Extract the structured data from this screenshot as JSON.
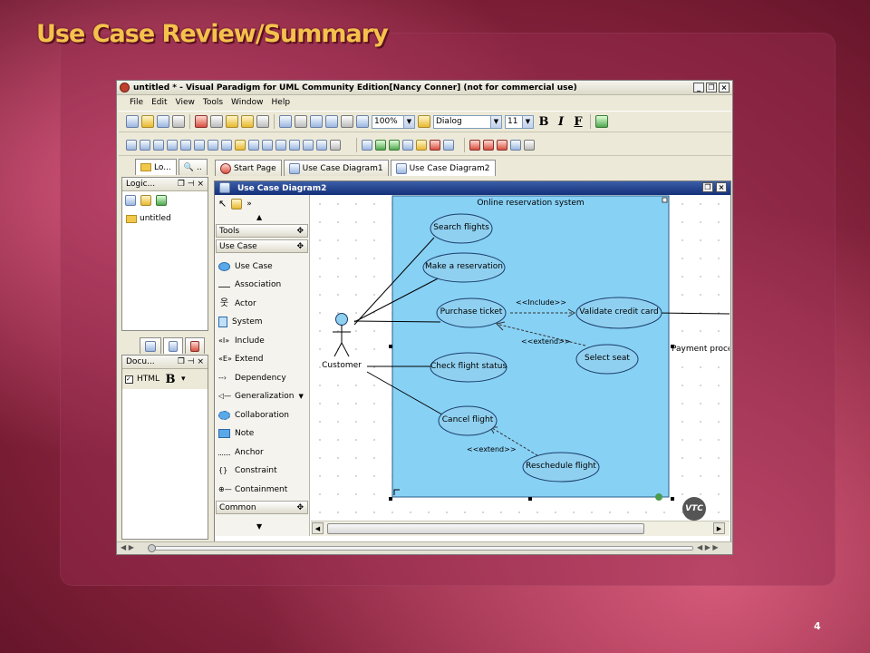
{
  "slide": {
    "title": "Use Case Review/Summary",
    "page_number": "4"
  },
  "window": {
    "title": "untitled * - Visual Paradigm for UML Community Edition[Nancy Conner] (not for commercial use)",
    "menu": [
      "File",
      "Edit",
      "View",
      "Tools",
      "Window",
      "Help"
    ],
    "zoom": "100%",
    "font_name": "Dialog",
    "font_size": "11",
    "format_buttons": [
      "B",
      "I",
      "F"
    ]
  },
  "left_panels": {
    "top_tabs": [
      "Lo...",
      ".."
    ],
    "logical_title": "Logic...",
    "tree_item": "untitled",
    "doc_title": "Docu...",
    "html_label": "HTML",
    "html_bold": "B"
  },
  "doc_tabs": [
    "Start Page",
    "Use Case Diagram1",
    "Use Case Diagram2"
  ],
  "diagram": {
    "title": "Use Case Diagram2",
    "palette_sections": [
      "Tools",
      "Use Case",
      "Common"
    ],
    "palette_items": [
      "Use Case",
      "Association",
      "Actor",
      "System",
      "Include",
      "Extend",
      "Dependency",
      "Generalization",
      "Collaboration",
      "Note",
      "Anchor",
      "Constraint",
      "Containment"
    ],
    "system_name": "Online reservation system",
    "actor": "Customer",
    "use_cases": [
      "Search flights",
      "Make a reservation",
      "Purchase ticket",
      "Validate credit card",
      "Select seat",
      "Check flight status",
      "Cancel flight",
      "Reschedule flight"
    ],
    "relations": {
      "include": "<<Include>>",
      "extend1": "<<extend>>",
      "extend2": "<<extend>>"
    },
    "external_actor": "Payment proce",
    "watermark": "VTC"
  },
  "colors": {
    "title_gold": "#f4c24c",
    "system_fill": "#87d1f5",
    "usecase_fill": "#8fd0f0",
    "window_titlebar": "#1f3f8a"
  }
}
